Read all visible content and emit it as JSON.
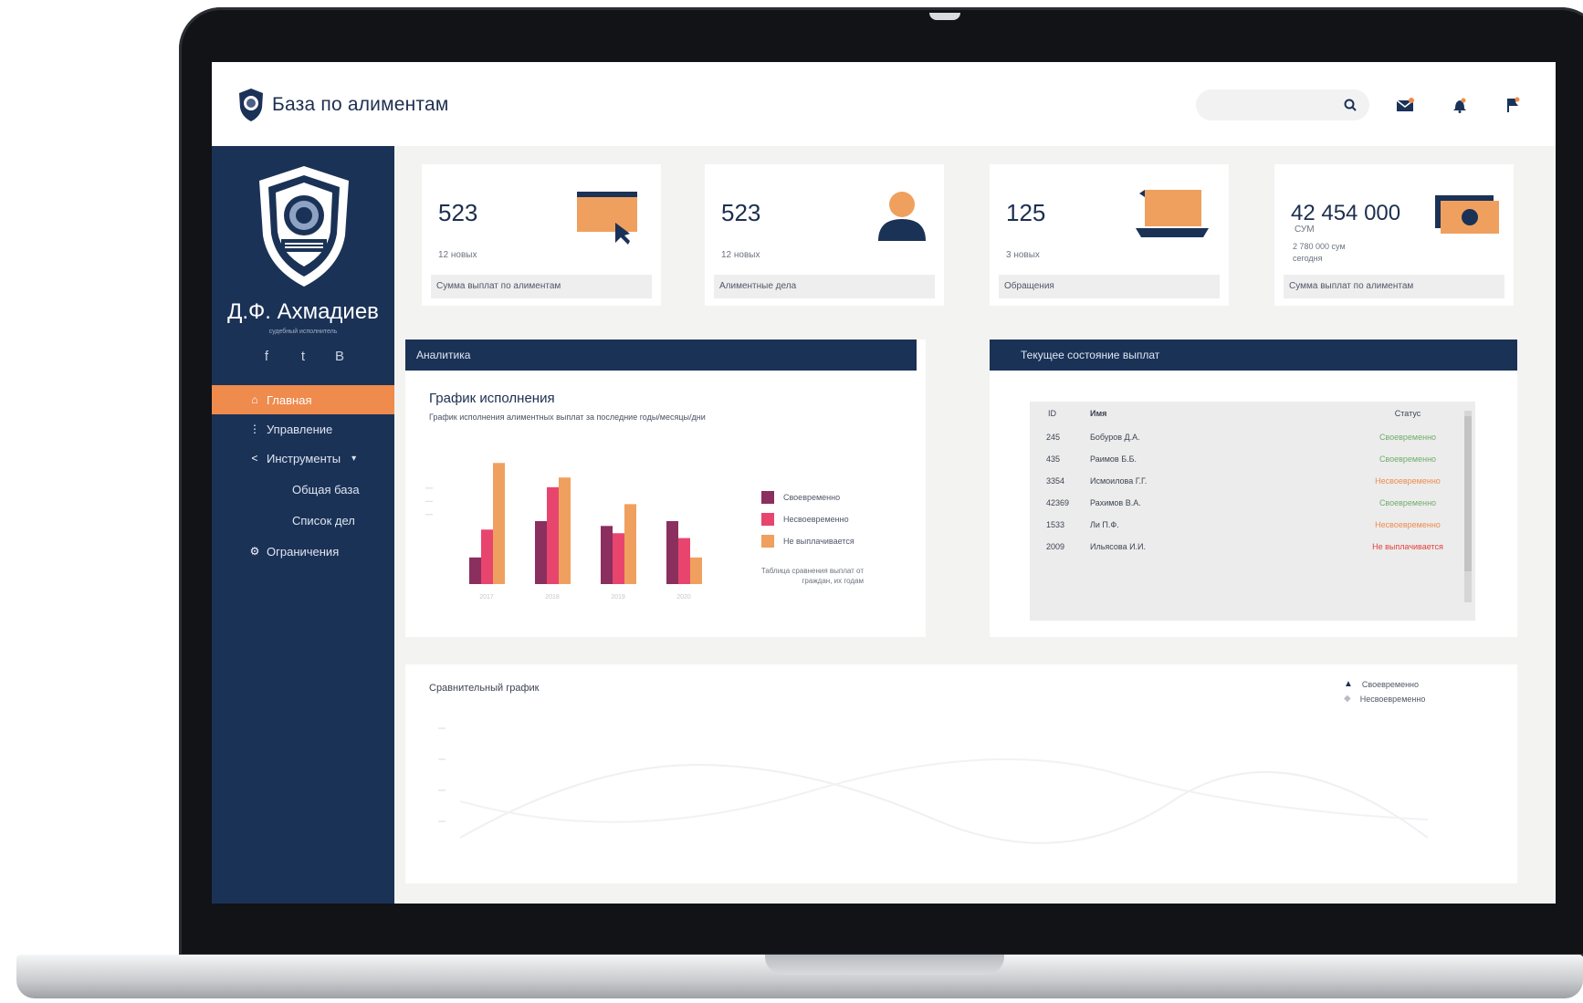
{
  "app": {
    "title": "База по алиментам"
  },
  "topbar": {
    "icons": [
      "search-icon",
      "mail-icon",
      "bell-icon",
      "flag-icon"
    ]
  },
  "profile": {
    "name": "Д.Ф. Ахмадиев",
    "role": "судебный исполнитель",
    "socials": [
      "f",
      "t",
      "B"
    ]
  },
  "sidebar": {
    "items": [
      {
        "label": "Главная",
        "icon": "home-icon",
        "active": true
      },
      {
        "label": "Управление",
        "icon": "share-icon",
        "active": false
      },
      {
        "label": "Инструменты",
        "icon": "tools-icon",
        "active": false,
        "expanded": true
      },
      {
        "label": "Общая база",
        "icon": "",
        "active": false,
        "sub": true
      },
      {
        "label": "Список дел",
        "icon": "",
        "active": false,
        "sub": true
      },
      {
        "label": "Ограничения",
        "icon": "settings-icon",
        "active": false
      }
    ]
  },
  "stats": [
    {
      "value": "523",
      "sub": "12 новых",
      "footer": "Сумма выплат по алиментам",
      "icon": "monitor-icon",
      "currency": "",
      "extra": ""
    },
    {
      "value": "523",
      "sub": "12 новых",
      "footer": "Алиментные дела",
      "icon": "user-icon",
      "currency": "",
      "extra": ""
    },
    {
      "value": "125",
      "sub": "3 новых",
      "footer": "Обращения",
      "icon": "laptop-icon",
      "currency": "",
      "extra": ""
    },
    {
      "value": "42 454 000",
      "sub": "",
      "footer": "Сумма выплат по алиментам",
      "icon": "money-icon",
      "currency": "СУМ",
      "extra": "2 780 000 сум сегодня"
    }
  ],
  "analytics": {
    "header": "Аналитика",
    "chart_title": "График исполнения",
    "chart_subtitle": "График исполнения алиментных выплат за последние годы/месяцы/дни",
    "legend_note": "Таблица сравнения выплат от граждан, их годам"
  },
  "chart_data": {
    "type": "bar",
    "categories": [
      "2017",
      "2018",
      "2019",
      "2020"
    ],
    "series": [
      {
        "name": "Своевременно",
        "color": "#8a2f5e",
        "values": [
          22,
          52,
          48,
          52
        ]
      },
      {
        "name": "Несвоевременно",
        "color": "#e8456e",
        "values": [
          45,
          80,
          42,
          38
        ]
      },
      {
        "name": "Не выплачивается",
        "color": "#f0a05e",
        "values": [
          100,
          88,
          66,
          22
        ]
      }
    ],
    "ylim": [
      0,
      110
    ],
    "legend": "right"
  },
  "payments": {
    "header": "Текущее состояние выплат",
    "columns": [
      "ID",
      "Имя",
      "Статус"
    ],
    "rows": [
      {
        "id": "245",
        "name": "Бобуров Д.А.",
        "status": "Своевременно",
        "status_color": "#6fae6a"
      },
      {
        "id": "435",
        "name": "Раимов Б.Б.",
        "status": "Своевременно",
        "status_color": "#6fae6a"
      },
      {
        "id": "3354",
        "name": "Исмоилова Г.Г.",
        "status": "Несвоевременно",
        "status_color": "#ee8b4d"
      },
      {
        "id": "42369",
        "name": "Рахимов В.А.",
        "status": "Своевременно",
        "status_color": "#6fae6a"
      },
      {
        "id": "1533",
        "name": "Ли П.Ф.",
        "status": "Несвоевременно",
        "status_color": "#ee8b4d"
      },
      {
        "id": "2009",
        "name": "Ильясова И.И.",
        "status": "Не выплачивается",
        "status_color": "#e0443c"
      }
    ]
  },
  "comparison": {
    "title": "Сравнительный график",
    "legend": [
      "Своевременно",
      "Несвоевременно"
    ]
  },
  "colors": {
    "navy": "#1b3257",
    "orange": "#ee8b4d",
    "background": "#f3f3f2"
  }
}
